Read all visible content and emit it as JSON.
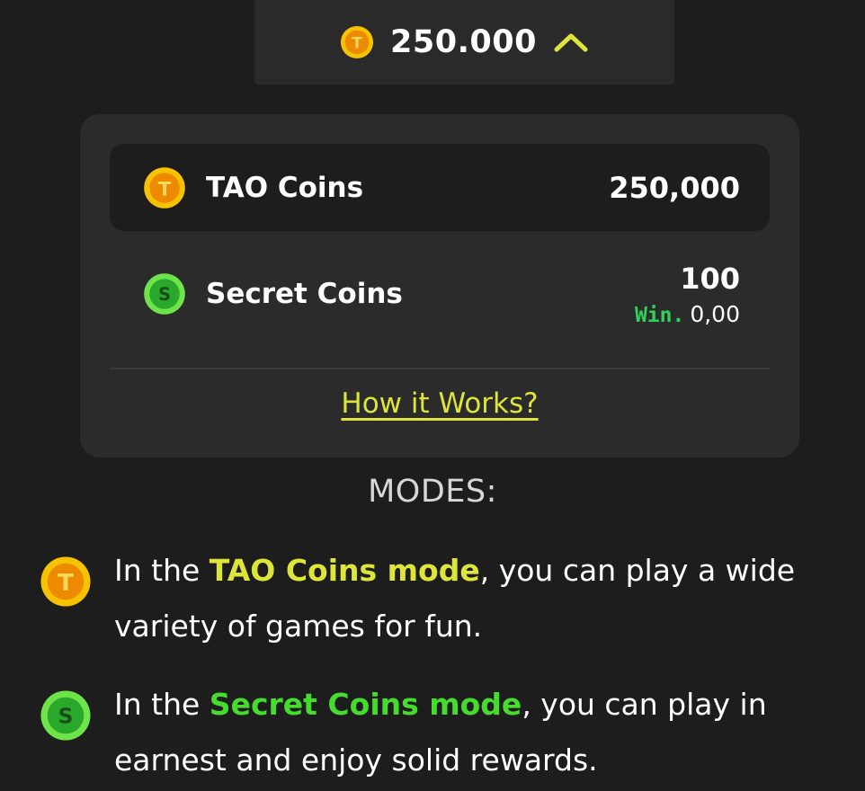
{
  "balance_toggle": {
    "amount": "250.000",
    "icons": {
      "coin": "tao-coin-icon",
      "toggle": "chevron-up-icon"
    }
  },
  "wallet": {
    "tao": {
      "label": "TAO Coins",
      "value": "250,000",
      "icon": "tao-coin-icon"
    },
    "secret": {
      "label": "Secret Coins",
      "value": "100",
      "win_label": "Win.",
      "win_value": "0,00",
      "icon": "secret-coin-icon"
    },
    "how_link": "How it Works?"
  },
  "modes": {
    "title": "MODES:",
    "tao": {
      "prefix": "In the ",
      "highlight": "TAO Coins mode",
      "suffix": ", you can play a wide variety of games for fun."
    },
    "secret": {
      "prefix": "In the ",
      "highlight": "Secret Coins mode",
      "suffix": ", you can play in earnest and enjoy solid rewards."
    }
  },
  "colors": {
    "background": "#1d1d1d",
    "panel": "#2b2b2b",
    "accent_yellow": "#dde43a",
    "accent_green": "#45dc2e",
    "win_green": "#2fd35a"
  }
}
